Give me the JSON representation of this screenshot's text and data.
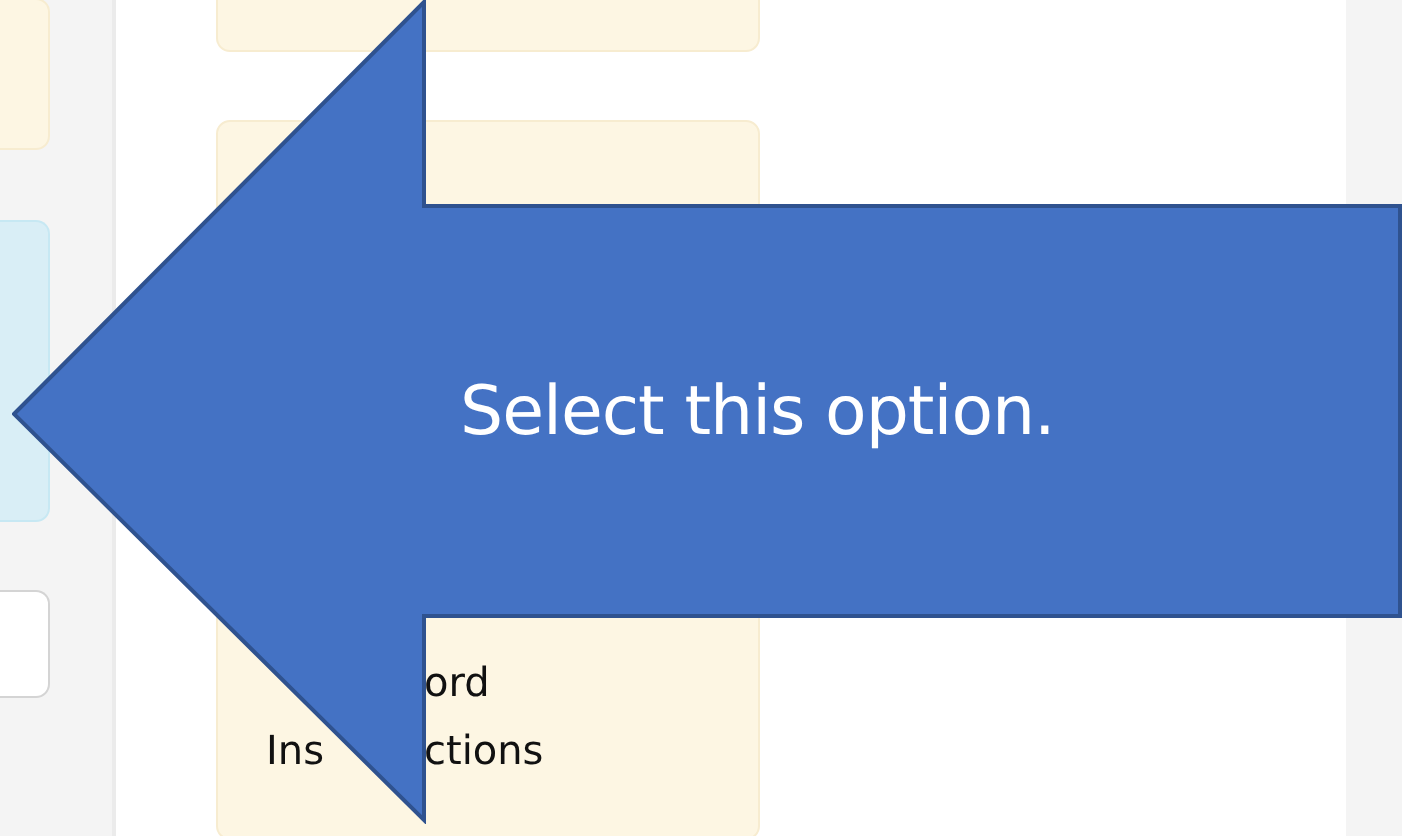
{
  "sidebar": {
    "cards": [
      {
        "kind": "note"
      },
      {
        "kind": "highlight"
      },
      {
        "kind": "button"
      }
    ]
  },
  "main": {
    "cards": [
      {
        "kind": "note"
      },
      {
        "kind": "note",
        "lines": [
          {
            "right": "ord"
          },
          {
            "left": "Ins",
            "right": "ctions"
          }
        ]
      }
    ]
  },
  "callout": {
    "text": "Select this option."
  }
}
